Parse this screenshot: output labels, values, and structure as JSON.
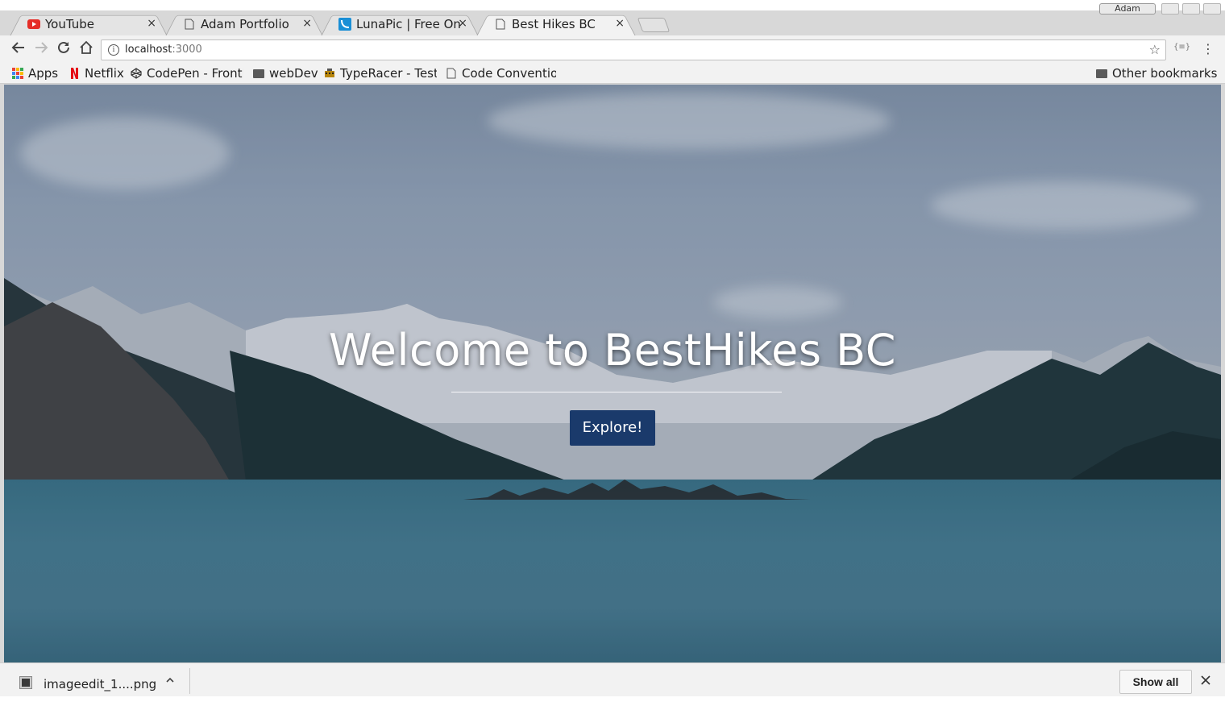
{
  "browser": {
    "tabs": [
      {
        "title": "YouTube",
        "icon": "youtube-icon",
        "active": false
      },
      {
        "title": "Adam Portfolio",
        "icon": "page-icon",
        "active": false
      },
      {
        "title": "LunaPic | Free Onlin",
        "icon": "lunapic-icon",
        "active": false
      },
      {
        "title": "Best Hikes BC",
        "icon": "page-icon",
        "active": true
      }
    ],
    "tab_close_glyph": "×",
    "profile_name": "Adam",
    "address": {
      "host": "localhost",
      "port": ":3000"
    },
    "extension_label": "{≡}"
  },
  "bookmarks": {
    "items": [
      {
        "label": "Apps",
        "icon": "apps-grid-icon"
      },
      {
        "label": "Netflix",
        "icon": "netflix-icon"
      },
      {
        "label": "CodePen - Front",
        "fade": " E",
        "icon": "codepen-icon"
      },
      {
        "label": "webDev",
        "icon": "folder-icon"
      },
      {
        "label": "TypeRacer - Test",
        "fade": " y",
        "icon": "typeracer-icon"
      },
      {
        "label": "Code Convention",
        "fade": "",
        "icon": "page-icon"
      }
    ],
    "other": "Other bookmarks"
  },
  "hero": {
    "title": "Welcome to BestHikes BC",
    "button": "Explore!"
  },
  "downloads": {
    "file_name": "imageedit_1....png",
    "show_all": "Show all"
  },
  "colors": {
    "button_bg": "#1a3a6b",
    "youtube_red": "#e52d27",
    "netflix_red": "#e50914",
    "lunapic_blue": "#1a8fd6"
  }
}
